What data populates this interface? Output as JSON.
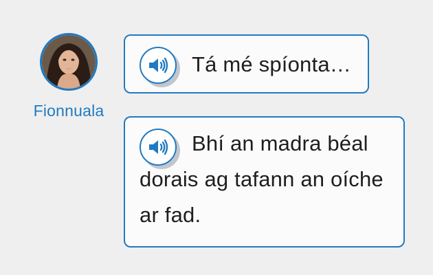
{
  "speaker": {
    "name": "Fionnuala",
    "avatar_icon": "woman-portrait",
    "accent_color": "#1f7ac2"
  },
  "messages": [
    {
      "text": "Tá mé spíonta…",
      "audio_icon": "speaker-volume-icon"
    },
    {
      "text": "Bhí an madra béal dorais ag tafann an oíche ar fad.",
      "audio_icon": "speaker-volume-icon"
    }
  ]
}
